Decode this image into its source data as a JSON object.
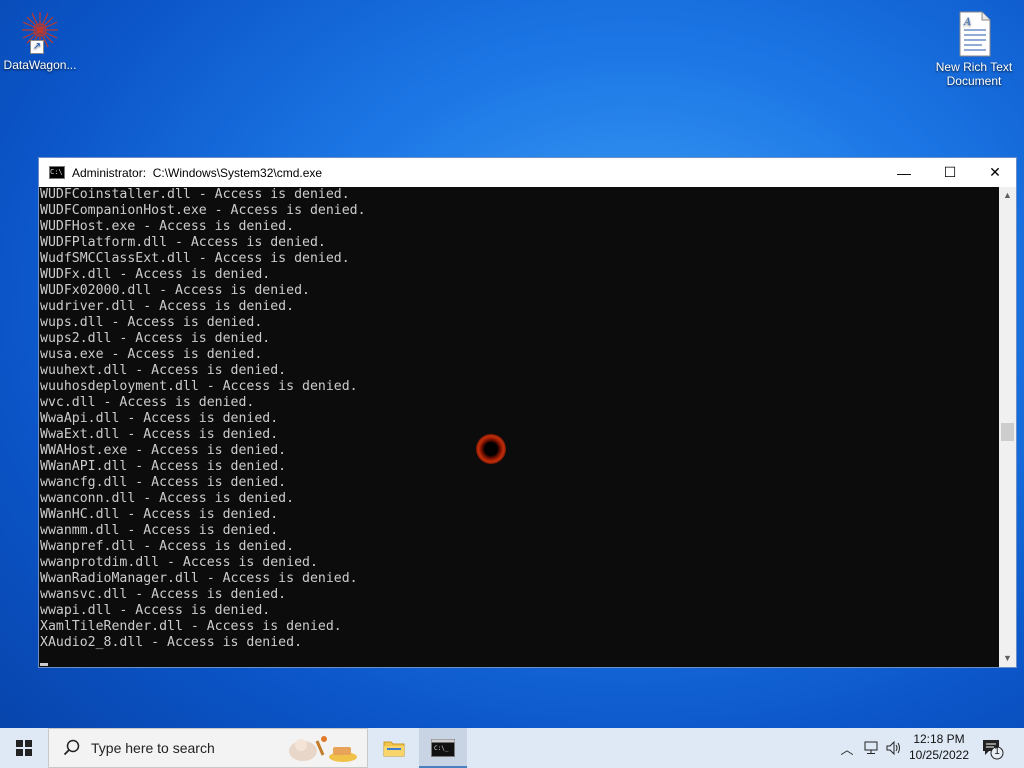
{
  "desktop": {
    "icons": [
      {
        "label": "DataWagon..."
      },
      {
        "label": "New Rich Text Document"
      }
    ]
  },
  "window": {
    "title": "Administrator:  C:\\Windows\\System32\\cmd.exe",
    "controls": {
      "minimize": "—",
      "maximize": "☐",
      "close": "✕"
    }
  },
  "console": {
    "lines": [
      "WUDFCoinstaller.dll - Access is denied.",
      "WUDFCompanionHost.exe - Access is denied.",
      "WUDFHost.exe - Access is denied.",
      "WUDFPlatform.dll - Access is denied.",
      "WudfSMCClassExt.dll - Access is denied.",
      "WUDFx.dll - Access is denied.",
      "WUDFx02000.dll - Access is denied.",
      "wudriver.dll - Access is denied.",
      "wups.dll - Access is denied.",
      "wups2.dll - Access is denied.",
      "wusa.exe - Access is denied.",
      "wuuhext.dll - Access is denied.",
      "wuuhosdeployment.dll - Access is denied.",
      "wvc.dll - Access is denied.",
      "WwaApi.dll - Access is denied.",
      "WwaExt.dll - Access is denied.",
      "WWAHost.exe - Access is denied.",
      "WWanAPI.dll - Access is denied.",
      "wwancfg.dll - Access is denied.",
      "wwanconn.dll - Access is denied.",
      "WWanHC.dll - Access is denied.",
      "wwanmm.dll - Access is denied.",
      "Wwanpref.dll - Access is denied.",
      "wwanprotdim.dll - Access is denied.",
      "WwanRadioManager.dll - Access is denied.",
      "wwansvc.dll - Access is denied.",
      "wwapi.dll - Access is denied.",
      "XamlTileRender.dll - Access is denied.",
      "XAudio2_8.dll - Access is denied."
    ]
  },
  "taskbar": {
    "search_placeholder": "Type here to search",
    "clock_time": "12:18 PM",
    "clock_date": "10/25/2022",
    "notification_count": "1"
  },
  "colors": {
    "console_bg": "#0c0c0c",
    "console_text": "#cccccc",
    "taskbar_bg": "#dfe9f5",
    "desktop_accent": "#1d78e6"
  }
}
